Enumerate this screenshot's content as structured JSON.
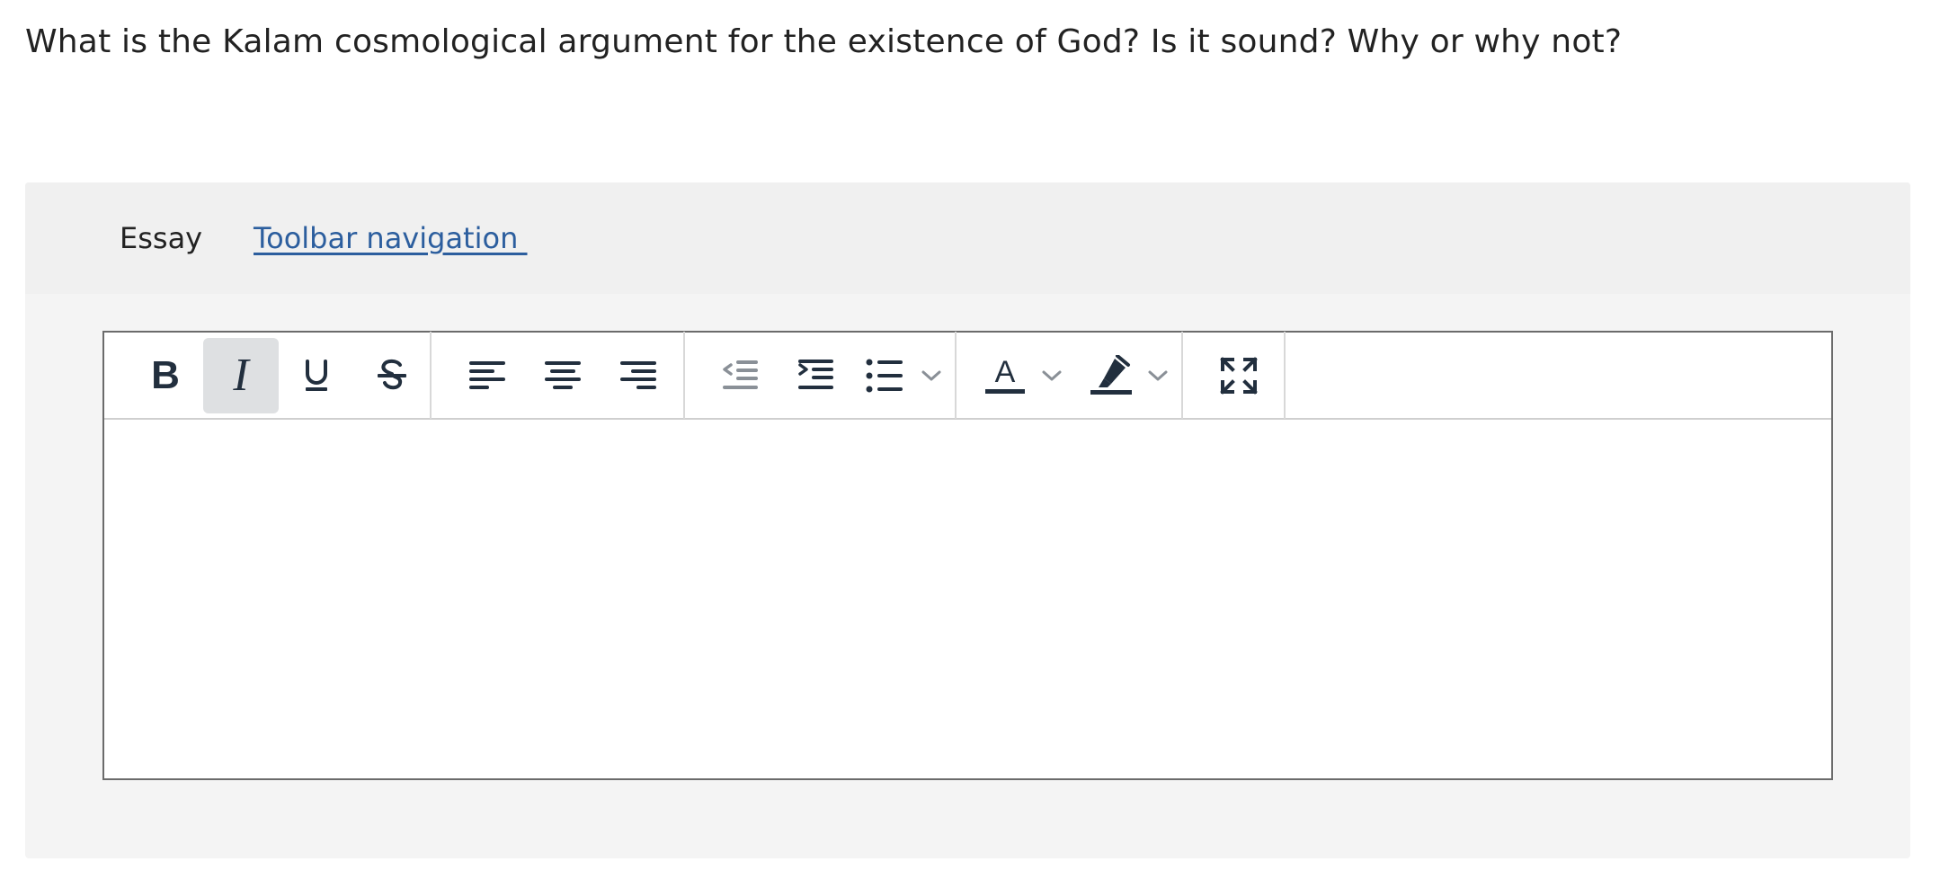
{
  "question": {
    "text": "What is the Kalam cosmological argument for the existence of God? Is it sound? Why or why not?"
  },
  "essay": {
    "label": "Essay",
    "toolbar_nav_link": "Toolbar navigation "
  },
  "toolbar": {
    "bold_label": "B",
    "italic_label": "I",
    "text_color_glyph": "A",
    "active_button": "italic",
    "colors": {
      "icon": "#222f3e",
      "icon_disabled": "#8a9097",
      "chevron": "#8a9097",
      "active_bg": "#dee0e2",
      "link": "#2c5e9e"
    }
  }
}
